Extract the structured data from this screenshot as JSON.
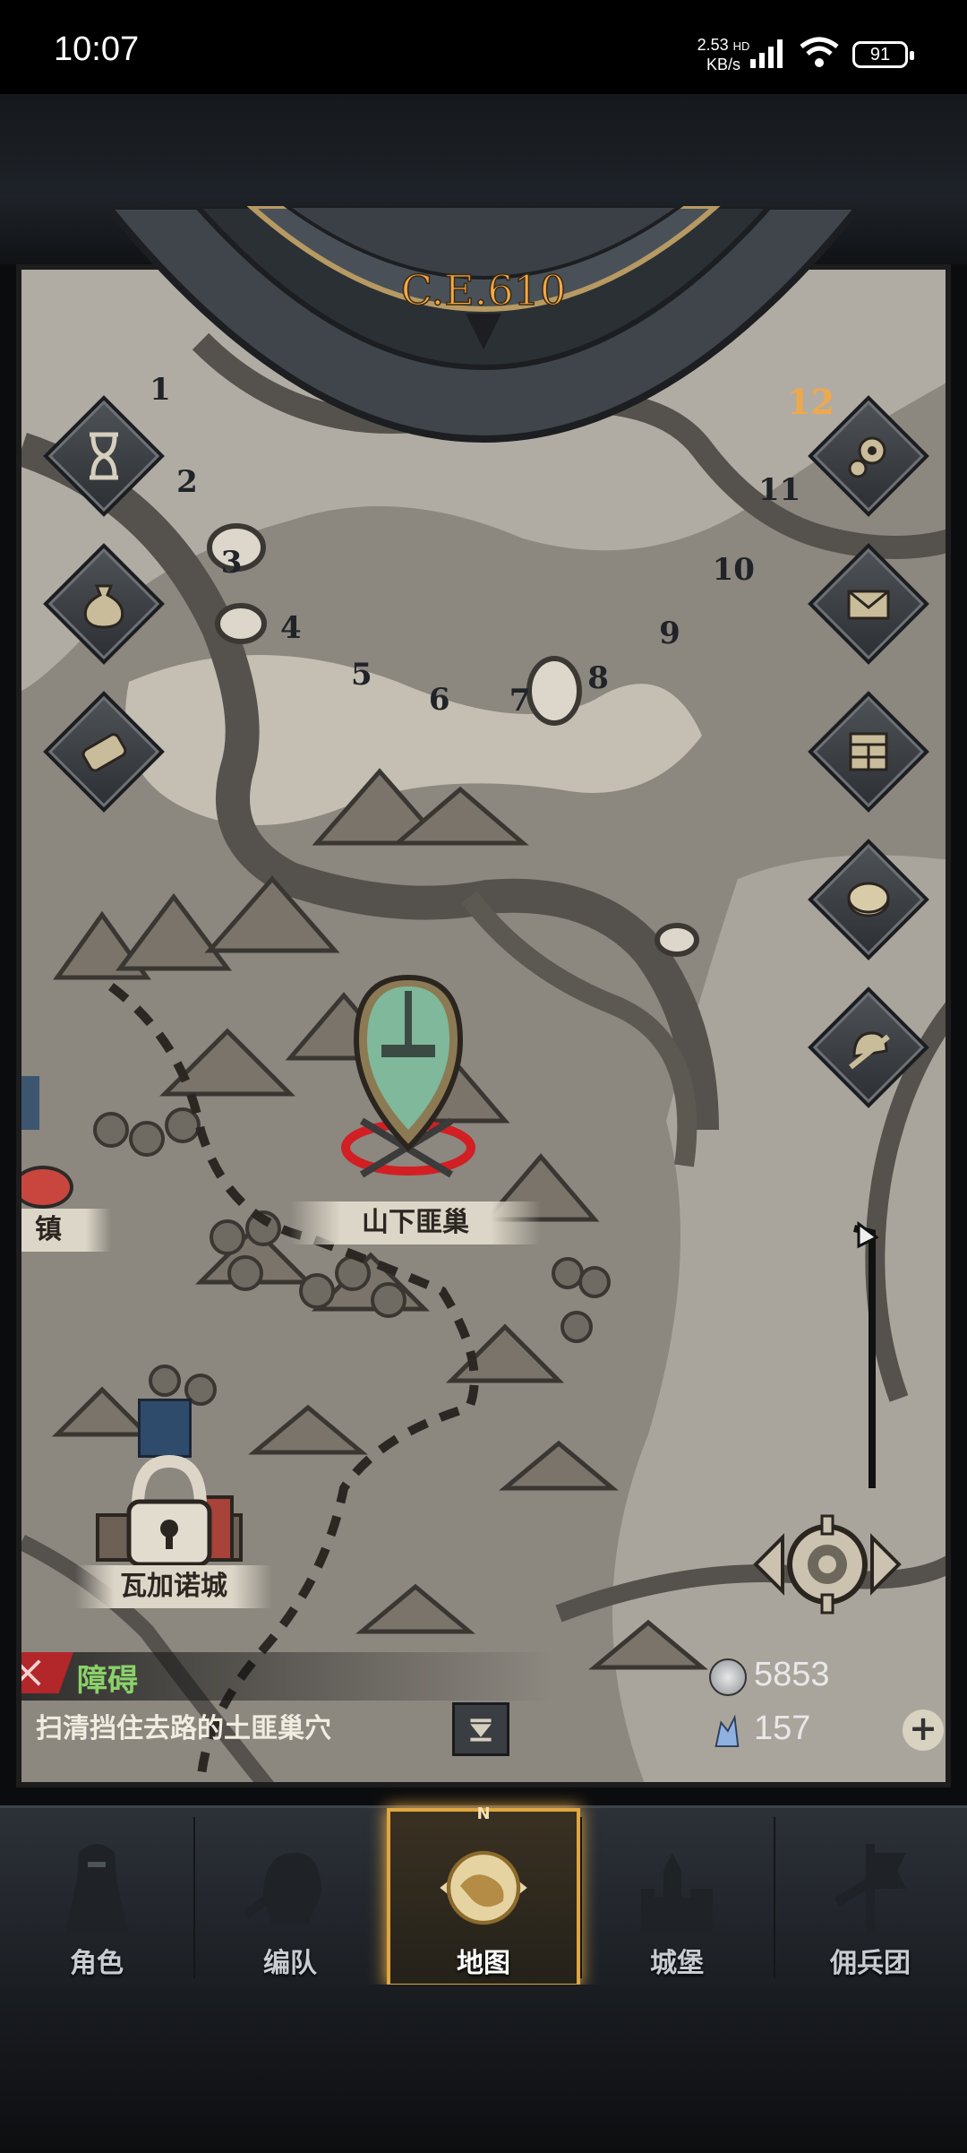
{
  "status_bar": {
    "time": "10:07",
    "net_speed_value": "2.53",
    "net_speed_unit": "KB/s",
    "net_tag": "HD",
    "battery": "91"
  },
  "dial": {
    "year": "C.E.610",
    "months": [
      "1",
      "2",
      "3",
      "4",
      "5",
      "6",
      "7",
      "8",
      "9",
      "10",
      "11",
      "12"
    ],
    "current_month": "12"
  },
  "left_buttons": [
    {
      "icon": "hourglass-icon"
    },
    {
      "icon": "money-bag-icon"
    },
    {
      "icon": "scroll-icon"
    }
  ],
  "right_buttons": [
    {
      "icon": "gear-icon"
    },
    {
      "icon": "mail-icon"
    },
    {
      "icon": "board-icon"
    },
    {
      "icon": "coin-icon"
    },
    {
      "icon": "helmet-sword-icon"
    }
  ],
  "locations": {
    "bandit_lair": "山下匪巢",
    "town_partial": "镇",
    "locked_city": "瓦加诺城"
  },
  "quest": {
    "title": "障碍",
    "description": "扫清挡住去路的土匪巢穴"
  },
  "currency": {
    "silver": "5853",
    "crystal": "157"
  },
  "nav": {
    "items": [
      {
        "label": "角色",
        "icon": "knight-icon"
      },
      {
        "label": "编队",
        "icon": "helmet-icon"
      },
      {
        "label": "地图",
        "icon": "map-compass-icon",
        "compass_letter": "N",
        "active": true
      },
      {
        "label": "城堡",
        "icon": "castle-icon"
      },
      {
        "label": "佣兵团",
        "icon": "banner-icon"
      }
    ]
  },
  "colors": {
    "accent_gold": "#e0a640",
    "quest_green": "#8bd16a",
    "quest_red": "#b3262a",
    "marker_jade": "#7fb89a"
  }
}
